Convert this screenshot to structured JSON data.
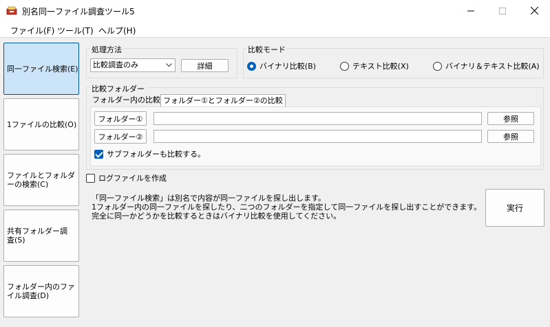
{
  "window": {
    "title": "別名同一ファイル調査ツール5"
  },
  "menu": [
    "ファイル(F)",
    "ツール(T)",
    "ヘルプ(H)"
  ],
  "sidebar": [
    {
      "label": "同一ファイル検索(E)",
      "active": true
    },
    {
      "label": "1ファイルの比較(O)",
      "active": false
    },
    {
      "label": "ファイルとフォルダーの検索(C)",
      "active": false
    },
    {
      "label": "共有フォルダー調査(S)",
      "active": false
    },
    {
      "label": "フォルダー内のファイル調査(D)",
      "active": false
    }
  ],
  "processing": {
    "title": "処理方法",
    "selected": "比較調査のみ",
    "detail_button": "詳細"
  },
  "compare_mode": {
    "title": "比較モード",
    "options": [
      {
        "label": "バイナリ比較(B)",
        "selected": true
      },
      {
        "label": "テキスト比較(X)",
        "selected": false
      },
      {
        "label": "バイナリ＆テキスト比較(A)",
        "selected": false
      }
    ]
  },
  "compare_folder": {
    "title": "比較フォルダー",
    "tabs": [
      {
        "label": "フォルダー内の比較",
        "active": false
      },
      {
        "label": "フォルダー①とフォルダー②の比較",
        "active": true
      }
    ],
    "folder1": {
      "button": "フォルダー①",
      "value": "",
      "browse": "参照"
    },
    "folder2": {
      "button": "フォルダー②",
      "value": "",
      "browse": "参照"
    },
    "subfolder": {
      "label": "サブフォルダーも比較する。",
      "checked": true
    }
  },
  "logfile": {
    "label": "ログファイルを作成",
    "checked": false
  },
  "description": {
    "line1": "「同一ファイル検索」は別名で内容が同一ファイルを探し出します。",
    "line2": "1フォルダー内の同一ファイルを探したり、二つのフォルダーを指定して同一ファイルを探し出すことができます。",
    "line3": "完全に同一かどうかを比較するときはバイナリ比較を使用してください。"
  },
  "execute_button": "実行",
  "colors": {
    "accent": "#005fb8",
    "active_side": "#cce4f7"
  }
}
